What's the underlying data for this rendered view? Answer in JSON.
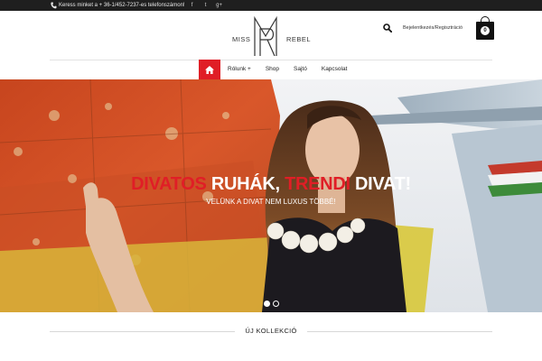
{
  "topbar": {
    "phone_icon": "phone-icon",
    "contact_text": "Keress minket a + 36-1/452-7237-es telefonszámon!",
    "social": [
      {
        "icon": "facebook-icon",
        "glyph": "f"
      },
      {
        "icon": "twitter-icon",
        "glyph": "t"
      },
      {
        "icon": "google-plus-icon",
        "glyph": "g+"
      }
    ]
  },
  "header": {
    "logo_left": "MISS",
    "logo_right": "REBEL",
    "login_label": "Bejelentkezés/Regisztráció",
    "cart_count": "0"
  },
  "nav": {
    "home_icon": "home-icon",
    "items": [
      "Rólunk +",
      "Shop",
      "Sajtó",
      "Kapcsolat"
    ]
  },
  "hero": {
    "title_part1": "DIVATOS ",
    "title_part2": "RUHÁK, ",
    "title_part3": "TRENDI ",
    "title_part4": "DIVAT!",
    "subtitle": "VELÜNK A DIVAT NEM LUXUS TÖBBÉ!",
    "slides_total": 2,
    "slide_active": 1
  },
  "section": {
    "title": "ÚJ KOLLEKCIÓ"
  },
  "colors": {
    "accent": "#e01e26",
    "topbar": "#1f1f1f"
  }
}
